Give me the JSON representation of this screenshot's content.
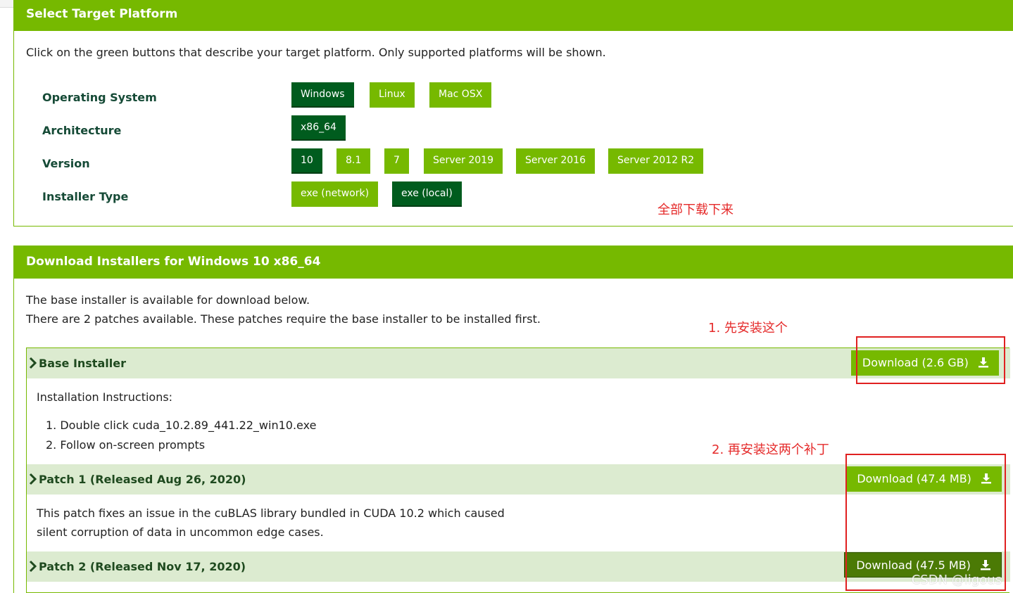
{
  "platform": {
    "title": "Select Target Platform",
    "description": "Click on the green buttons that describe your target platform. Only supported platforms will be shown.",
    "rows": [
      {
        "label": "Operating System",
        "options": [
          "Windows",
          "Linux",
          "Mac OSX"
        ],
        "selected": "Windows"
      },
      {
        "label": "Architecture",
        "options": [
          "x86_64"
        ],
        "selected": "x86_64"
      },
      {
        "label": "Version",
        "options": [
          "10",
          "8.1",
          "7",
          "Server 2019",
          "Server 2016",
          "Server 2012 R2"
        ],
        "selected": "10"
      },
      {
        "label": "Installer Type",
        "options": [
          "exe (network)",
          "exe (local)"
        ],
        "selected": "exe (local)"
      }
    ]
  },
  "annotations": {
    "download_all": "全部下载下来",
    "step1": "1. 先安装这个",
    "step2": "2. 再安装这两个补丁"
  },
  "installers": {
    "title": "Download Installers for Windows 10 x86_64",
    "line1": "The base installer is available for download below.",
    "line2": "There are 2 patches available. These patches require the base installer to be installed first.",
    "base": {
      "title": "Base Installer",
      "download_label": "Download (2.6 GB)",
      "instructions_heading": "Installation Instructions:",
      "steps": [
        "1. Double click cuda_10.2.89_441.22_win10.exe",
        "2. Follow on-screen prompts"
      ]
    },
    "patch1": {
      "title": "Patch 1 (Released Aug 26, 2020)",
      "download_label": "Download (47.4 MB)",
      "description_1": "This patch fixes an issue in the cuBLAS library bundled in CUDA 10.2 which caused",
      "description_2": "silent corruption of data in uncommon edge cases."
    },
    "patch2": {
      "title": "Patch 2 (Released Nov 17, 2020)",
      "download_label": "Download (47.5 MB)"
    }
  },
  "watermark": "CSDN @ligous",
  "colors": {
    "accent": "#76b900",
    "selected": "#005c1e",
    "annotation": "#e52b2b"
  },
  "icons": {
    "download": "download-icon",
    "expand": "chevron-right-icon"
  }
}
